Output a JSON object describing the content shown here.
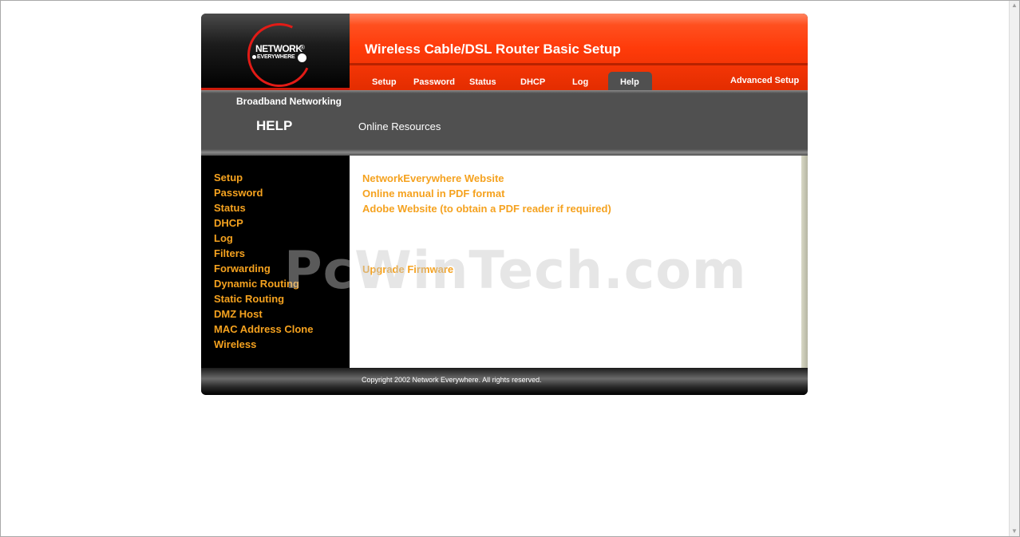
{
  "header": {
    "logo": {
      "line1": "NETWORK",
      "line2": "EVERYWHERE",
      "reg": "®"
    },
    "page_heading": "Wireless Cable/DSL Router Basic Setup",
    "tabs": [
      {
        "label": "Setup"
      },
      {
        "label": "Password"
      },
      {
        "label": "Status"
      },
      {
        "label": "DHCP"
      },
      {
        "label": "Log"
      },
      {
        "label": "Help",
        "active": true
      }
    ],
    "advanced_setup": "Advanced Setup"
  },
  "band": {
    "tagline": "Broadband Networking",
    "section_title": "HELP",
    "section_subtitle": "Online Resources"
  },
  "sidebar": {
    "items": [
      {
        "label": "Setup"
      },
      {
        "label": "Password"
      },
      {
        "label": "Status"
      },
      {
        "label": "DHCP"
      },
      {
        "label": "Log"
      },
      {
        "label": "Filters"
      },
      {
        "label": "Forwarding"
      },
      {
        "label": "Dynamic Routing"
      },
      {
        "label": "Static Routing"
      },
      {
        "label": "DMZ Host"
      },
      {
        "label": "MAC Address Clone"
      },
      {
        "label": "Wireless"
      }
    ]
  },
  "content": {
    "links": [
      {
        "label": "NetworkEverywhere Website"
      },
      {
        "label": "Online manual in PDF format"
      },
      {
        "label": "Adobe Website (to obtain a PDF reader if required)"
      }
    ],
    "upgrade_link": "Upgrade Firmware"
  },
  "watermark": "PcWinTech.com",
  "footer": {
    "copyright": "Copyright 2002 Network Everywhere. All rights reserved."
  },
  "colors": {
    "accent_orange": "#f5a21f",
    "header_red": "#ff3b0a",
    "band_gray": "#505050",
    "logo_red": "#e21b16"
  }
}
